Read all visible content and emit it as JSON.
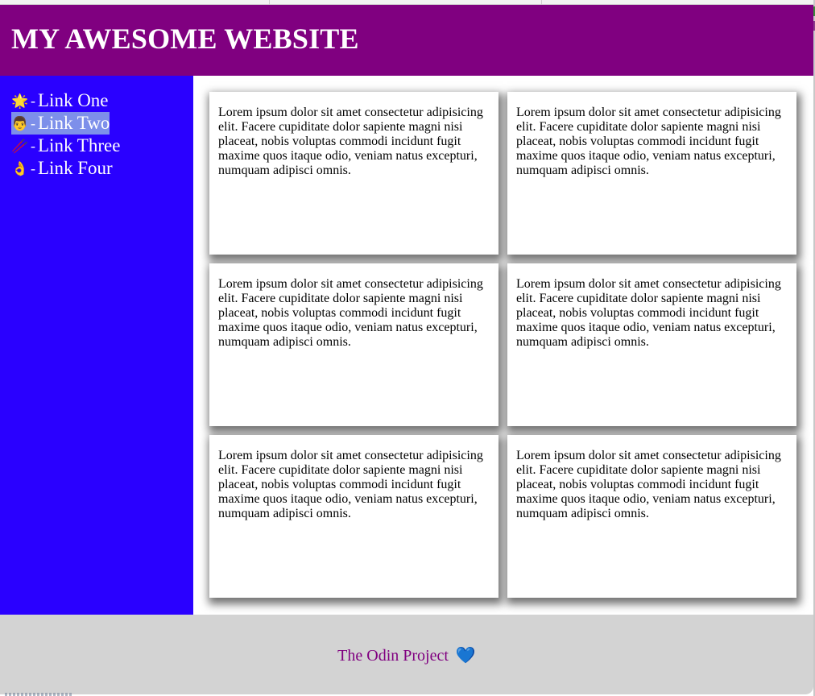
{
  "header": {
    "title": "MY AWESOME WEBSITE"
  },
  "sidebar": {
    "separator": "-",
    "links": [
      {
        "icon": "🌟",
        "icon_name": "glowing-star-icon",
        "label": "Link One"
      },
      {
        "icon": "👨",
        "icon_name": "man-face-icon",
        "label": "Link Two",
        "selected": true
      },
      {
        "icon": "🥢",
        "icon_name": "chopsticks-icon",
        "label": "Link Three"
      },
      {
        "icon": "👌",
        "icon_name": "ok-hand-icon",
        "label": "Link Four"
      }
    ]
  },
  "cards": [
    {
      "text": "Lorem ipsum dolor sit amet consectetur adipisicing elit. Facere cupiditate dolor sapiente magni nisi placeat, nobis voluptas commodi incidunt fugit maxime quos itaque odio, veniam natus excepturi, numquam adipisci omnis."
    },
    {
      "text": "Lorem ipsum dolor sit amet consectetur adipisicing elit. Facere cupiditate dolor sapiente magni nisi placeat, nobis voluptas commodi incidunt fugit maxime quos itaque odio, veniam natus excepturi, numquam adipisci omnis."
    },
    {
      "text": "Lorem ipsum dolor sit amet consectetur adipisicing elit. Facere cupiditate dolor sapiente magni nisi placeat, nobis voluptas commodi incidunt fugit maxime quos itaque odio, veniam natus excepturi, numquam adipisci omnis."
    },
    {
      "text": "Lorem ipsum dolor sit amet consectetur adipisicing elit. Facere cupiditate dolor sapiente magni nisi placeat, nobis voluptas commodi incidunt fugit maxime quos itaque odio, veniam natus excepturi, numquam adipisci omnis."
    },
    {
      "text": "Lorem ipsum dolor sit amet consectetur adipisicing elit. Facere cupiditate dolor sapiente magni nisi placeat, nobis voluptas commodi incidunt fugit maxime quos itaque odio, veniam natus excepturi, numquam adipisci omnis."
    },
    {
      "text": "Lorem ipsum dolor sit amet consectetur adipisicing elit. Facere cupiditate dolor sapiente magni nisi placeat, nobis voluptas commodi incidunt fugit maxime quos itaque odio, veniam natus excepturi, numquam adipisci omnis."
    }
  ],
  "footer": {
    "text": "The Odin Project",
    "heart": "💙",
    "heart_name": "blue-heart-icon"
  },
  "colors": {
    "header_bg": "#800080",
    "sidebar_bg": "#2a00ff",
    "selected_link_bg": "#7d8fea",
    "footer_bg": "#d3d3d3",
    "footer_text": "#800080",
    "heart": "#3d8bff"
  }
}
